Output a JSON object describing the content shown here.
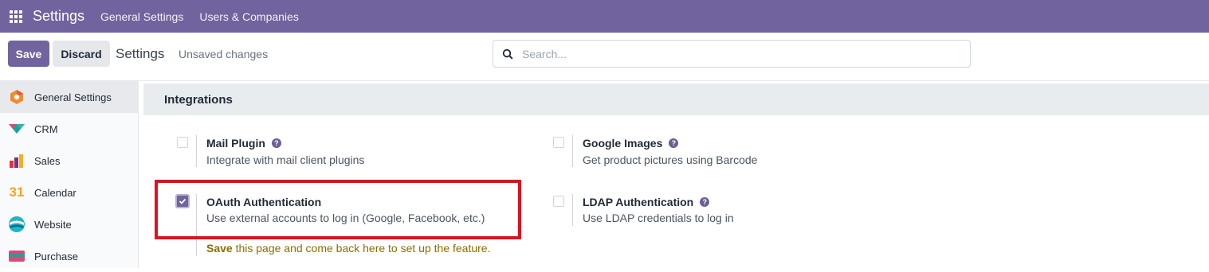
{
  "navbar": {
    "app_title": "Settings",
    "menu": [
      "General Settings",
      "Users & Companies"
    ]
  },
  "control_panel": {
    "save_label": "Save",
    "discard_label": "Discard",
    "title": "Settings",
    "status": "Unsaved changes",
    "search_placeholder": "Search..."
  },
  "sidebar": {
    "items": [
      {
        "label": "General Settings",
        "icon": "settings-app-icon",
        "active": true
      },
      {
        "label": "CRM",
        "icon": "crm-app-icon"
      },
      {
        "label": "Sales",
        "icon": "sales-app-icon"
      },
      {
        "label": "Calendar",
        "icon": "calendar-app-icon",
        "icon_text": "31"
      },
      {
        "label": "Website",
        "icon": "website-app-icon"
      },
      {
        "label": "Purchase",
        "icon": "purchase-app-icon"
      }
    ]
  },
  "section": {
    "title": "Integrations",
    "settings": [
      {
        "label": "Mail Plugin",
        "description": "Integrate with mail client plugins",
        "checked": false,
        "help": "?"
      },
      {
        "label": "Google Images",
        "description": "Get product pictures using Barcode",
        "checked": false,
        "help": "?"
      },
      {
        "label": "OAuth Authentication",
        "description": "Use external accounts to log in (Google, Facebook, etc.)",
        "checked": true,
        "note_bold": "Save",
        "note_rest": " this page and come back here to set up the feature."
      },
      {
        "label": "LDAP Authentication",
        "description": "Use LDAP credentials to log in",
        "checked": false,
        "help": "?"
      }
    ]
  },
  "colors": {
    "brand": "#71639e",
    "highlight": "#e0111f",
    "note": "#8a6d00"
  }
}
